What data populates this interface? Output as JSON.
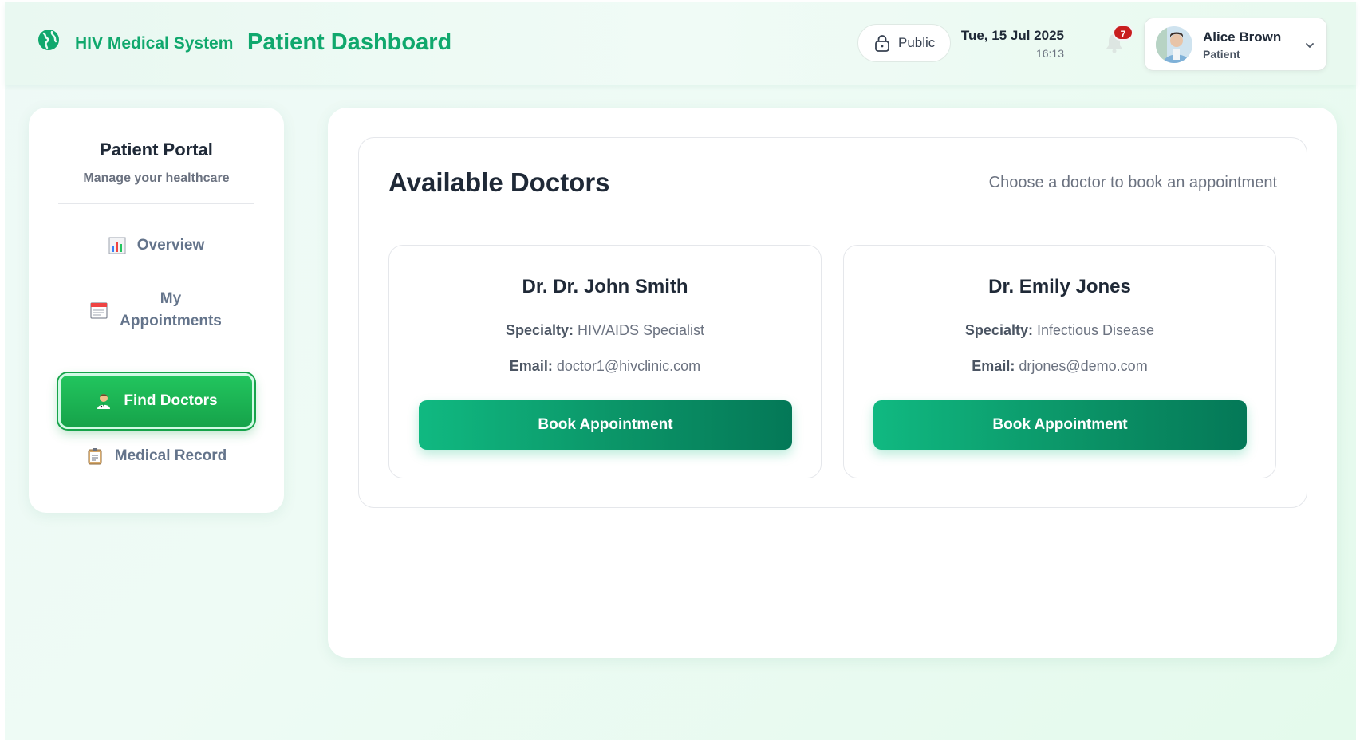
{
  "header": {
    "brand_icon": "globe-icon",
    "brand_name": "HIV Medical System",
    "page_title": "Patient Dashboard",
    "privacy_label": "Public",
    "privacy_icon": "lock-icon",
    "date": "Tue, 15 Jul 2025",
    "time": "16:13",
    "notifications_count": "7",
    "user": {
      "name": "Alice Brown",
      "role": "Patient",
      "avatar_icon": "avatar",
      "dropdown_icon": "chevron-down-icon"
    }
  },
  "sidebar": {
    "title": "Patient Portal",
    "subtitle": "Manage your healthcare",
    "items": [
      {
        "label": "Overview",
        "icon": "bar-chart-icon",
        "active": false
      },
      {
        "label": "My Appointments",
        "icon": "calendar-icon",
        "active": false
      },
      {
        "label": "Find Doctors",
        "icon": "doctor-icon",
        "active": true
      },
      {
        "label": "Medical Record",
        "icon": "clipboard-icon",
        "active": false
      }
    ]
  },
  "main": {
    "title": "Available Doctors",
    "subtitle": "Choose a doctor to book an appointment",
    "specialty_label": "Specialty:",
    "email_label": "Email:",
    "doctors": [
      {
        "name": "Dr. Dr. John Smith",
        "specialty": "HIV/AIDS Specialist",
        "email": "doctor1@hivclinic.com",
        "button": "Book Appointment"
      },
      {
        "name": "Dr. Emily Jones",
        "specialty": "Infectious Disease",
        "email": "drjones@demo.com",
        "button": "Book Appointment"
      }
    ]
  },
  "colors": {
    "accent": "#10a86d",
    "active_nav": "#16a34a",
    "badge": "#c81e1e"
  }
}
